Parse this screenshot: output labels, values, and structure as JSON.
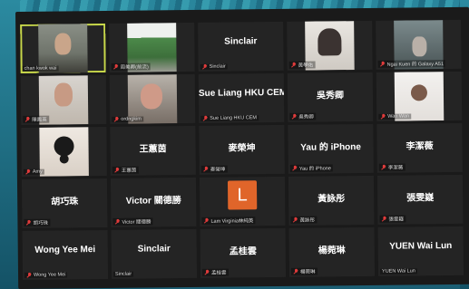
{
  "participants": [
    {
      "name": "",
      "label": "chan kwok wai",
      "mic_muted": false,
      "video": "v1",
      "active": true
    },
    {
      "name": "",
      "label": "周美卿(前流)",
      "mic_muted": true,
      "video": "v2"
    },
    {
      "name": "Sinclair",
      "label": "Sinclair",
      "mic_muted": true
    },
    {
      "name": "",
      "label": "黃學佑",
      "mic_muted": true,
      "video": "v3"
    },
    {
      "name": "",
      "label": "Ngai Kuen 的 Galaxy A51",
      "mic_muted": true,
      "video": "v4"
    },
    {
      "name": "",
      "label": "陳鳳英",
      "mic_muted": true,
      "video": "v5"
    },
    {
      "name": "",
      "label": "ordngkim",
      "mic_muted": true,
      "video": "v6"
    },
    {
      "name": "Sue Liang HKU CEM",
      "label": "Sue Liang HKU CEM",
      "mic_muted": true
    },
    {
      "name": "吳秀卿",
      "label": "吳秀卿",
      "mic_muted": true
    },
    {
      "name": "",
      "label": "Wan Wan",
      "mic_muted": true,
      "video": "v8"
    },
    {
      "name": "",
      "label": "Amy",
      "mic_muted": true,
      "video": "v7"
    },
    {
      "name": "王蕙茵",
      "label": "王蕙茵",
      "mic_muted": true
    },
    {
      "name": "麥榮坤",
      "label": "麥榮坤",
      "mic_muted": true
    },
    {
      "name": "Yau 的 iPhone",
      "label": "Yau 的 iPhone",
      "mic_muted": true
    },
    {
      "name": "李潔薇",
      "label": "李潔薇",
      "mic_muted": true
    },
    {
      "name": "胡巧珠",
      "label": "胡巧珠",
      "mic_muted": true
    },
    {
      "name": "Victor 關德勝",
      "label": "Victor 關德勝",
      "mic_muted": true
    },
    {
      "name": "",
      "label": "Lam Virginia林純英",
      "mic_muted": true,
      "avatar_letter": "L"
    },
    {
      "name": "黃詠彤",
      "label": "黃詠彤",
      "mic_muted": true
    },
    {
      "name": "張雯嶷",
      "label": "張雯嶷",
      "mic_muted": true
    },
    {
      "name": "Wong Yee Mei",
      "label": "Wong Yee Mei",
      "mic_muted": true
    },
    {
      "name": "Sinclair",
      "label": "Sinclair",
      "mic_muted": false
    },
    {
      "name": "孟桂雲",
      "label": "孟桂雲",
      "mic_muted": true
    },
    {
      "name": "楊菀琳",
      "label": "楊菀琳",
      "mic_muted": true
    },
    {
      "name": "YUEN Wai Lun",
      "label": "YUEN Wai Lun",
      "mic_muted": false
    }
  ],
  "colors": {
    "active_border": "#c8d84a",
    "muted_icon": "#e03b3b",
    "tile_bg": "#242424",
    "avatar_bg": "#e0652a"
  }
}
